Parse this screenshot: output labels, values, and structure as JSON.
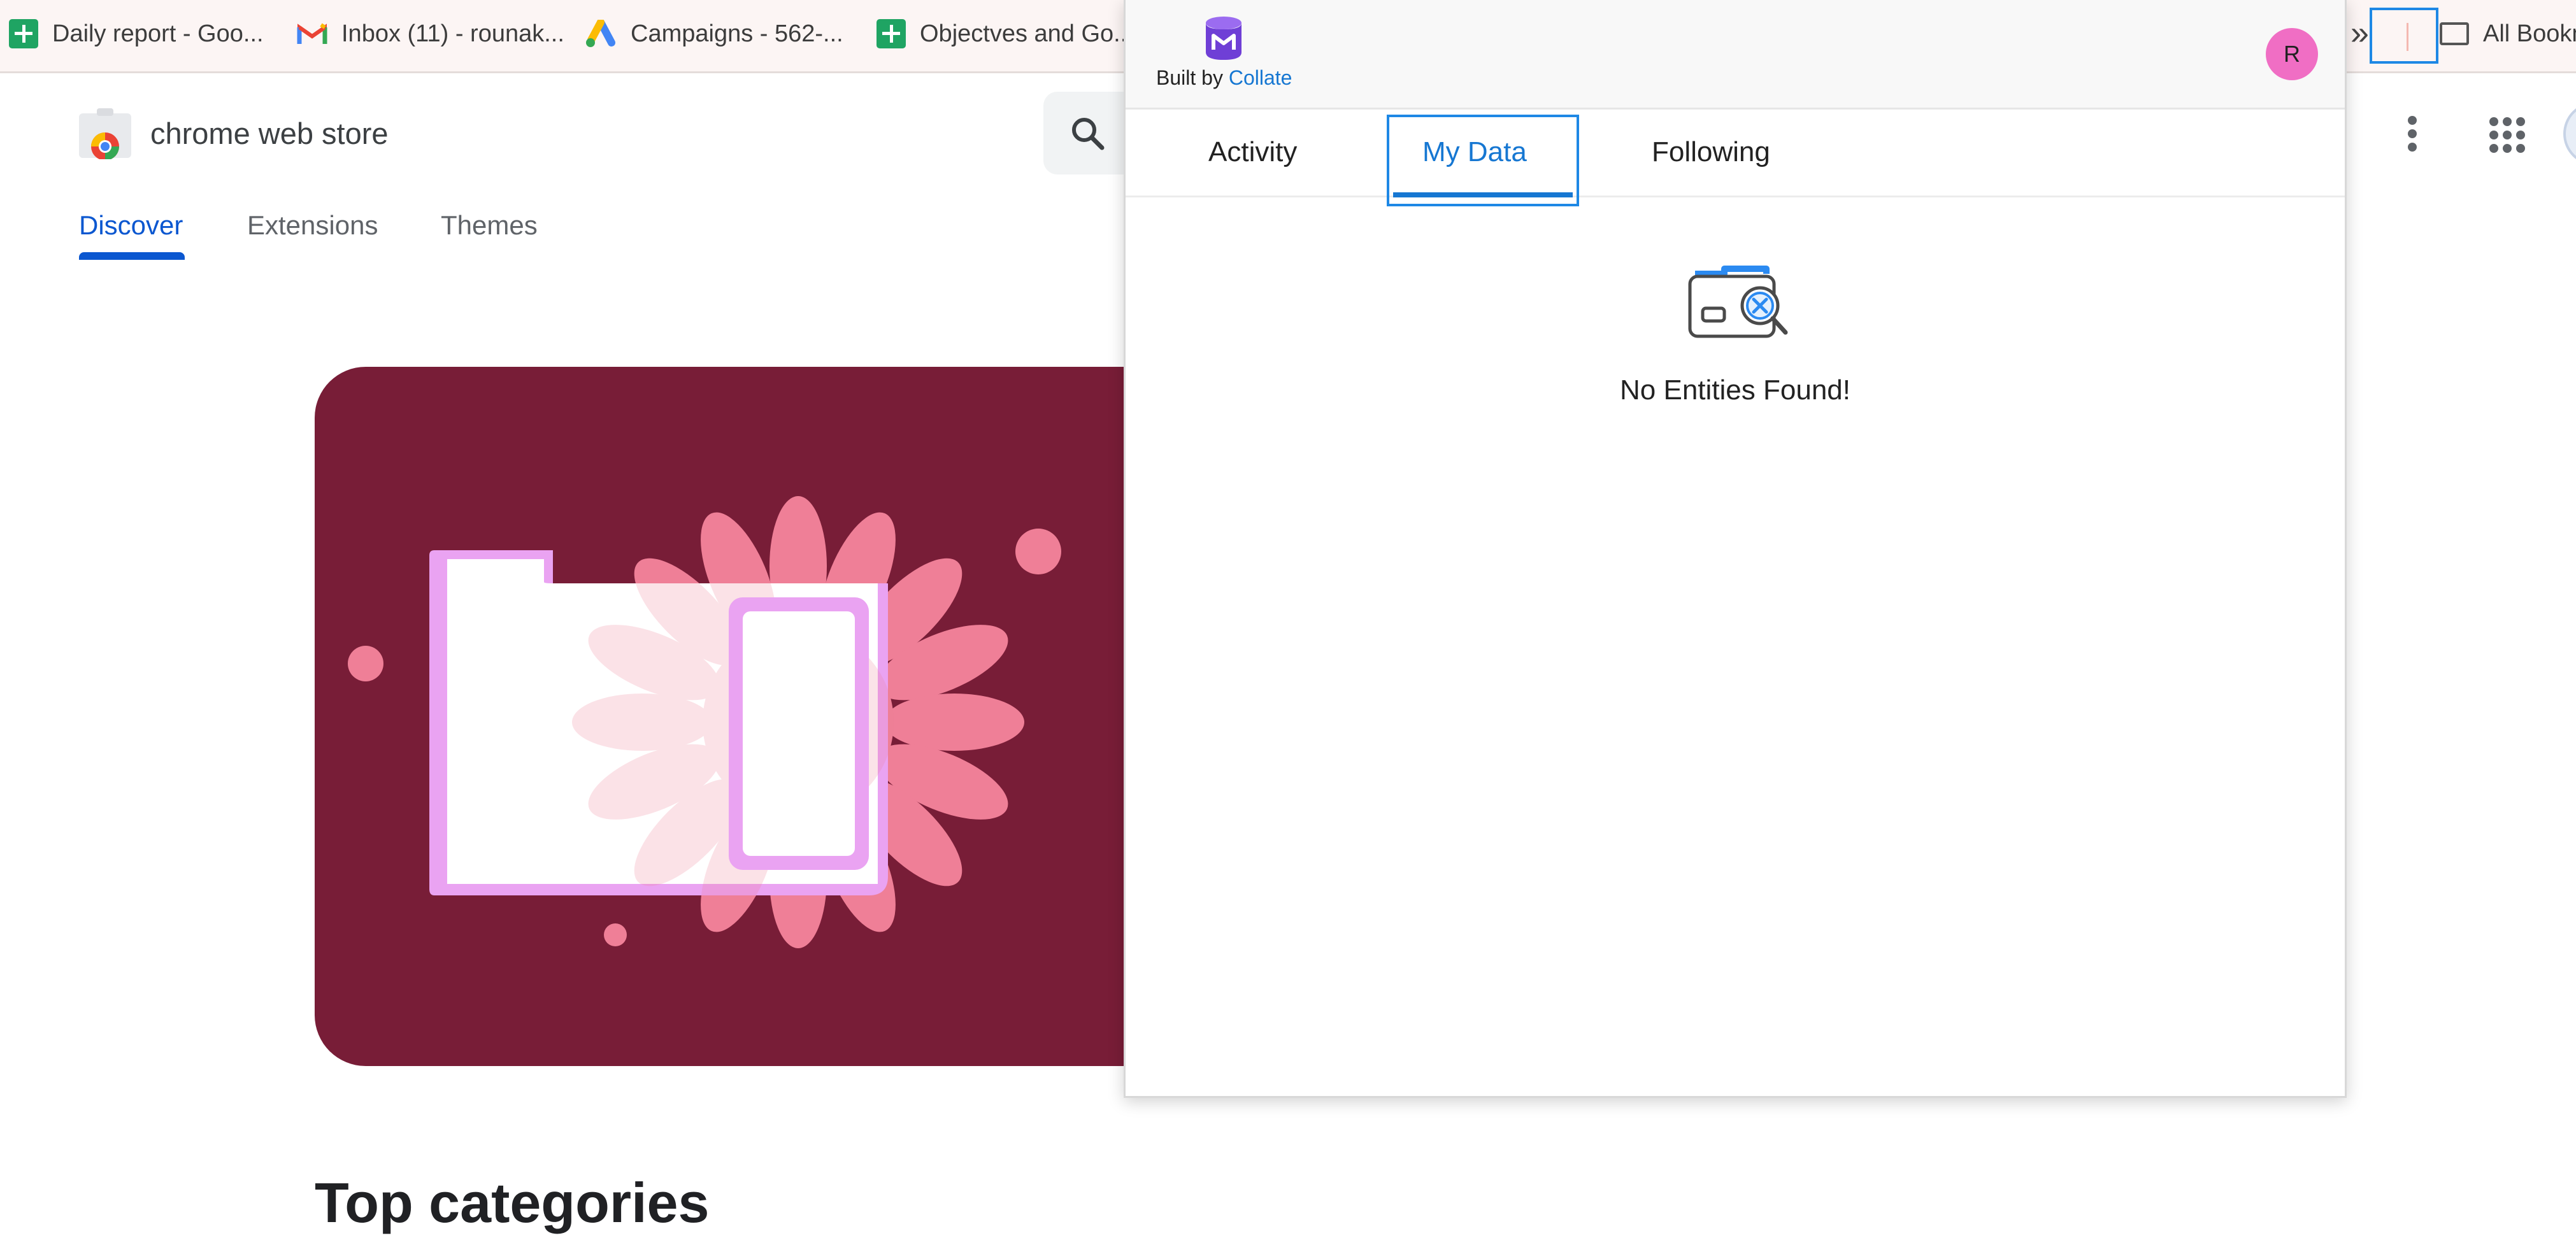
{
  "bookmarks": {
    "items": [
      {
        "label": "Daily report - Goo...",
        "icon": "google-sheets-icon"
      },
      {
        "label": "Inbox (11) - rounak...",
        "icon": "gmail-icon"
      },
      {
        "label": "Campaigns - 562-...",
        "icon": "google-ads-icon"
      },
      {
        "label": "Objectves and Go...",
        "icon": "google-sheets-icon"
      }
    ],
    "overflow_glyph": "»",
    "all_bookmarks_label": "All Bookm"
  },
  "store": {
    "title": "chrome web store",
    "nav": [
      "Discover",
      "Extensions",
      "Themes"
    ],
    "active_nav": "Discover",
    "section_heading": "Top categories",
    "hero_color": "#781d37"
  },
  "popup": {
    "built_by_prefix": "Built by",
    "built_by_brand": "Collate",
    "avatar_initial": "R",
    "avatar_color": "#f06ec4",
    "tabs": [
      "Activity",
      "My Data",
      "Following"
    ],
    "active_tab": "My Data",
    "empty_message": "No Entities Found!",
    "accent_color": "#1677d2"
  }
}
